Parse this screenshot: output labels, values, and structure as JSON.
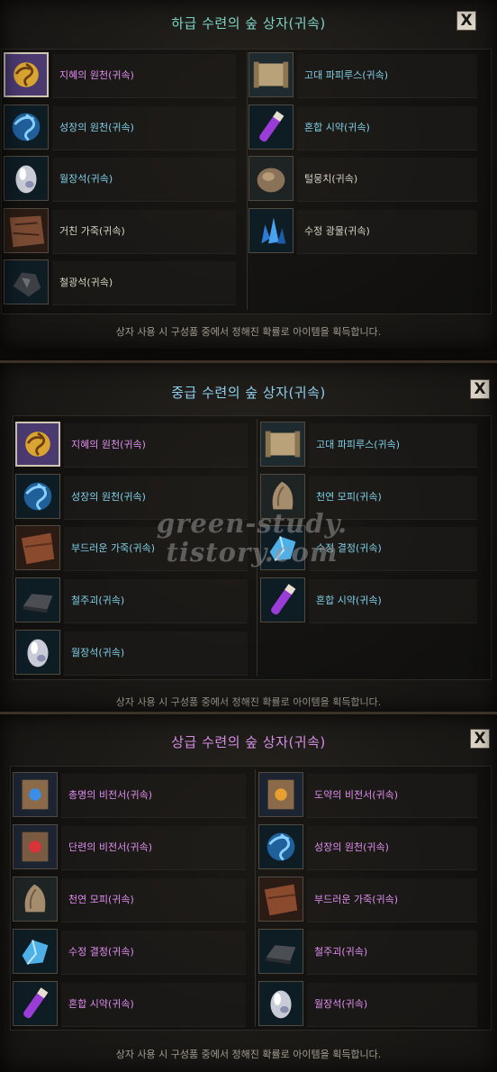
{
  "colors": {
    "violet": "#e08ef0",
    "cyan": "#7fd0e8",
    "teal": "#7fd6c8",
    "pink": "#d68fe6",
    "footer": "#a8a194"
  },
  "panels": [
    {
      "title": "하급 수련의 숲 상자(귀속)",
      "close_label": "X",
      "footer": "상자 사용 시 구성품 중에서 정해진 확률로 아이템을 획득합니다.",
      "left": [
        {
          "label": "지혜의 원천(귀속)",
          "icon": "wisdom-source-icon",
          "color": "#e08ef0",
          "selected": true
        },
        {
          "label": "성장의 원천(귀속)",
          "icon": "growth-source-icon",
          "color": "#7fd0e8"
        },
        {
          "label": "월장석(귀속)",
          "icon": "moonstone-icon",
          "color": "#7fd0e8"
        },
        {
          "label": "거친 가죽(귀속)",
          "icon": "rough-leather-icon",
          "color": "#d8d2c4"
        },
        {
          "label": "철광석(귀속)",
          "icon": "iron-ore-icon",
          "color": "#d8d2c4"
        }
      ],
      "right": [
        {
          "label": "고대 파피루스(귀속)",
          "icon": "papyrus-icon",
          "color": "#7fd0e8"
        },
        {
          "label": "혼합 시약(귀속)",
          "icon": "reagent-icon",
          "color": "#7fd0e8"
        },
        {
          "label": "털뭉치(귀속)",
          "icon": "fur-ball-icon",
          "color": "#d8d2c4"
        },
        {
          "label": "수정 광물(귀속)",
          "icon": "crystal-ore-icon",
          "color": "#d8d2c4"
        }
      ]
    },
    {
      "title": "중급 수련의 숲 상자(귀속)",
      "close_label": "X",
      "footer": "상자 사용 시 구성품 중에서 정해진 확률로 아이템을 획득합니다.",
      "left": [
        {
          "label": "지혜의 원천(귀속)",
          "icon": "wisdom-source-icon",
          "color": "#e08ef0",
          "selected": true
        },
        {
          "label": "성장의 원천(귀속)",
          "icon": "growth-source-icon",
          "color": "#7fd0e8"
        },
        {
          "label": "부드러운 가죽(귀속)",
          "icon": "soft-leather-icon",
          "color": "#7fd0e8"
        },
        {
          "label": "철주괴(귀속)",
          "icon": "iron-ingot-icon",
          "color": "#7fd0e8"
        },
        {
          "label": "월장석(귀속)",
          "icon": "moonstone-icon",
          "color": "#7fd0e8"
        }
      ],
      "right": [
        {
          "label": "고대 파피루스(귀속)",
          "icon": "papyrus-icon",
          "color": "#7fd0e8"
        },
        {
          "label": "천연 모피(귀속)",
          "icon": "natural-fur-icon",
          "color": "#7fd0e8"
        },
        {
          "label": "수정 결정(귀속)",
          "icon": "crystal-icon",
          "color": "#7fd0e8"
        },
        {
          "label": "혼합 시약(귀속)",
          "icon": "reagent-icon",
          "color": "#7fd0e8"
        }
      ]
    },
    {
      "title": "상급 수련의 숲 상자(귀속)",
      "close_label": "X",
      "footer": "상자 사용 시 구성품 중에서 정해진 확률로 아이템을 획득합니다.",
      "left": [
        {
          "label": "총명의 비전서(귀속)",
          "icon": "brilliance-scroll-icon",
          "color": "#e08ef0"
        },
        {
          "label": "단련의 비전서(귀속)",
          "icon": "training-scroll-icon",
          "color": "#e08ef0"
        },
        {
          "label": "천연 모피(귀속)",
          "icon": "natural-fur-icon",
          "color": "#e08ef0"
        },
        {
          "label": "수정 결정(귀속)",
          "icon": "crystal-icon",
          "color": "#e08ef0"
        },
        {
          "label": "혼합 시약(귀속)",
          "icon": "reagent-icon",
          "color": "#e08ef0"
        }
      ],
      "right": [
        {
          "label": "도약의 비전서(귀속)",
          "icon": "leap-scroll-icon",
          "color": "#e08ef0"
        },
        {
          "label": "성장의 원천(귀속)",
          "icon": "growth-source-icon",
          "color": "#e08ef0"
        },
        {
          "label": "부드러운 가죽(귀속)",
          "icon": "soft-leather-icon",
          "color": "#e08ef0"
        },
        {
          "label": "철주괴(귀속)",
          "icon": "iron-ingot-icon",
          "color": "#e08ef0"
        },
        {
          "label": "월장석(귀속)",
          "icon": "moonstone-icon",
          "color": "#e08ef0"
        }
      ]
    }
  ],
  "watermark": {
    "line1": "green-study.",
    "line2": "tistory.com"
  }
}
